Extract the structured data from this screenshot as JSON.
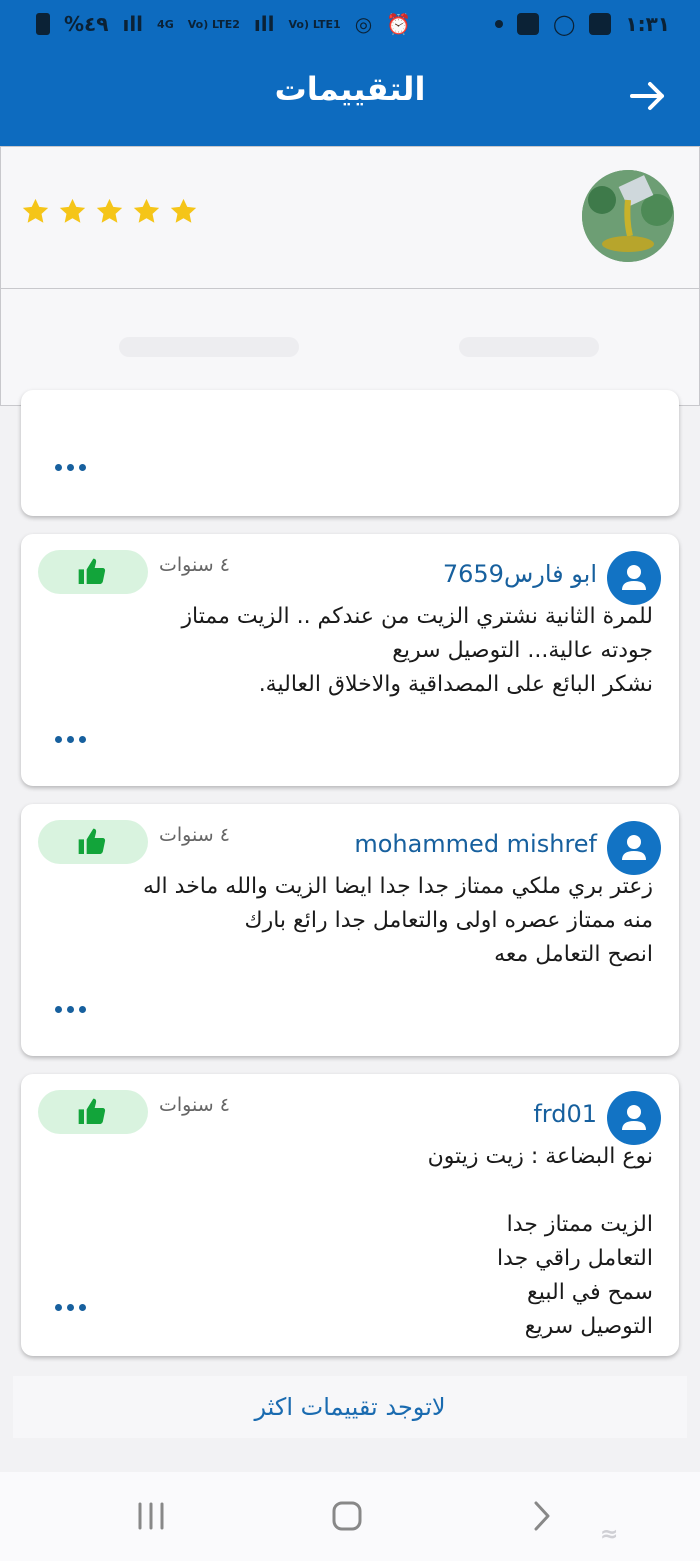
{
  "status_bar": {
    "battery": "%٤٩",
    "time": "١:٣١",
    "net1": "4G",
    "lte2": "Vo) LTE2",
    "lte1": "Vo) LTE1"
  },
  "header": {
    "title": "التقييمات"
  },
  "seller": {
    "rating_stars": 5,
    "star_color": "#f5c518"
  },
  "reviews": [
    {
      "more": "..."
    },
    {
      "username": "ابو فارس7659",
      "age": "٤ سنوات",
      "text": "للمرة الثانية نشتري الزيت من عندكم .. الزيت ممتاز\nجودته عالية... التوصيل سريع\n نشكر البائع على المصداقية والاخلاق العالية.",
      "more": "..."
    },
    {
      "username": "mohammed mishref",
      "age": "٤ سنوات",
      "text": "زعتر بري ملكي ممتاز جدا جدا ايضا الزيت والله ماخد اله\nمنه ممتاز عصره اولى والتعامل جدا رائع بارك\nانصح التعامل معه",
      "more": "..."
    },
    {
      "username": "frd01",
      "age": "٤ سنوات",
      "text": "نوع البضاعة : زيت زيتون\n\nالزيت ممتاز جدا\nالتعامل راقي جدا\nسمح في البيع\nالتوصيل سريع",
      "more": "..."
    }
  ],
  "no_more_label": "لاتوجد تقييمات اكثر",
  "colors": {
    "primary": "#0d6bbf",
    "like_bg": "#d9f3df",
    "like_icon": "#12a43a",
    "link": "#17609e"
  }
}
